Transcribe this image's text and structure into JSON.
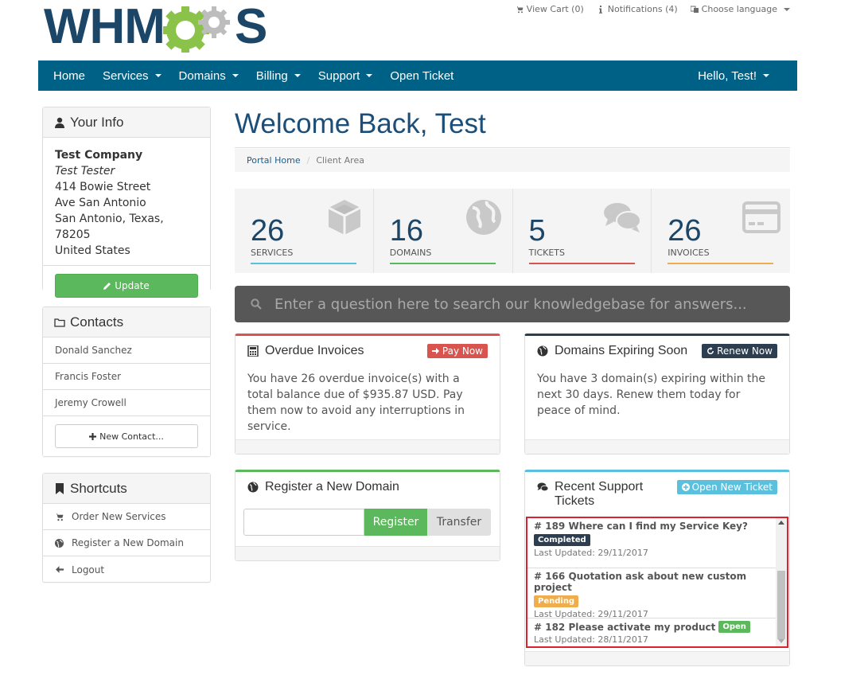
{
  "brand": {
    "logo_left": "WHM",
    "logo_right": "S",
    "logo_color": "#1b4668",
    "gear_colors": [
      "#8bc34a",
      "#bdbdbd"
    ]
  },
  "top_links": {
    "cart": "View Cart (0)",
    "notifications": "Notifications (4)",
    "language": "Choose language"
  },
  "nav": {
    "color": "#006187",
    "items": [
      {
        "label": "Home",
        "dropdown": false
      },
      {
        "label": "Services",
        "dropdown": true
      },
      {
        "label": "Domains",
        "dropdown": true
      },
      {
        "label": "Billing",
        "dropdown": true
      },
      {
        "label": "Support",
        "dropdown": true
      },
      {
        "label": "Open Ticket",
        "dropdown": false
      }
    ],
    "user": "Hello, Test!"
  },
  "sidebar": {
    "your_info": {
      "title": "Your Info",
      "company": "Test Company",
      "name": "Test Tester",
      "address_lines": [
        "414 Bowie Street",
        "Ave San Antonio",
        "San Antonio, Texas, 78205",
        "United States"
      ],
      "update_label": "Update"
    },
    "contacts": {
      "title": "Contacts",
      "items": [
        "Donald Sanchez",
        "Francis Foster",
        "Jeremy Crowell"
      ],
      "new_contact_label": "New Contact..."
    },
    "shortcuts": {
      "title": "Shortcuts",
      "items": [
        {
          "label": "Order New Services",
          "icon": "cart-icon"
        },
        {
          "label": "Register a New Domain",
          "icon": "globe-icon"
        },
        {
          "label": "Logout",
          "icon": "arrow-left-icon"
        }
      ]
    }
  },
  "main": {
    "title": "Welcome Back, Test",
    "breadcrumb": {
      "home": "Portal Home",
      "current": "Client Area"
    },
    "stats": [
      {
        "value": "26",
        "label": "SERVICES",
        "color": "#5bc0de",
        "icon": "cube-icon"
      },
      {
        "value": "16",
        "label": "DOMAINS",
        "color": "#5cb85c",
        "icon": "globe-icon"
      },
      {
        "value": "5",
        "label": "TICKETS",
        "color": "#d9534f",
        "icon": "comments-icon"
      },
      {
        "value": "26",
        "label": "INVOICES",
        "color": "#f0ad4e",
        "icon": "credit-card-icon"
      }
    ],
    "kb_search": {
      "placeholder": "Enter a question here to search our knowledgebase for answers..."
    },
    "overdue": {
      "title": "Overdue Invoices",
      "button": "Pay Now",
      "body": "You have 26 overdue invoice(s) with a total balance due of $935.87 USD. Pay them now to avoid any interruptions in service.",
      "accent": "#d9534f"
    },
    "expiring": {
      "title": "Domains Expiring Soon",
      "button": "Renew Now",
      "body": "You have 3 domain(s) expiring within the next 30 days. Renew them today for peace of mind.",
      "accent": "#2c3e50"
    },
    "register": {
      "title": "Register a New Domain",
      "input_value": "",
      "register_label": "Register",
      "transfer_label": "Transfer",
      "accent": "#5cb85c"
    },
    "tickets": {
      "title_line1": "Recent Support",
      "title_line2": "Tickets",
      "button": "Open New Ticket",
      "accent": "#5bc0de",
      "items": [
        {
          "title": "# 189 Where can I find my Service Key?",
          "status": "Completed",
          "status_color": "#2c3e50",
          "updated": "Last Updated: 29/11/2017",
          "inline": false
        },
        {
          "title": "# 166 Quotation ask about new custom project",
          "status": "Pending",
          "status_color": "#f0ad4e",
          "updated": "Last Updated: 29/11/2017",
          "inline": false
        },
        {
          "title": "# 182 Please activate my product",
          "status": "Open",
          "status_color": "#5cb85c",
          "updated": "Last Updated: 28/11/2017",
          "inline": true
        }
      ]
    }
  }
}
